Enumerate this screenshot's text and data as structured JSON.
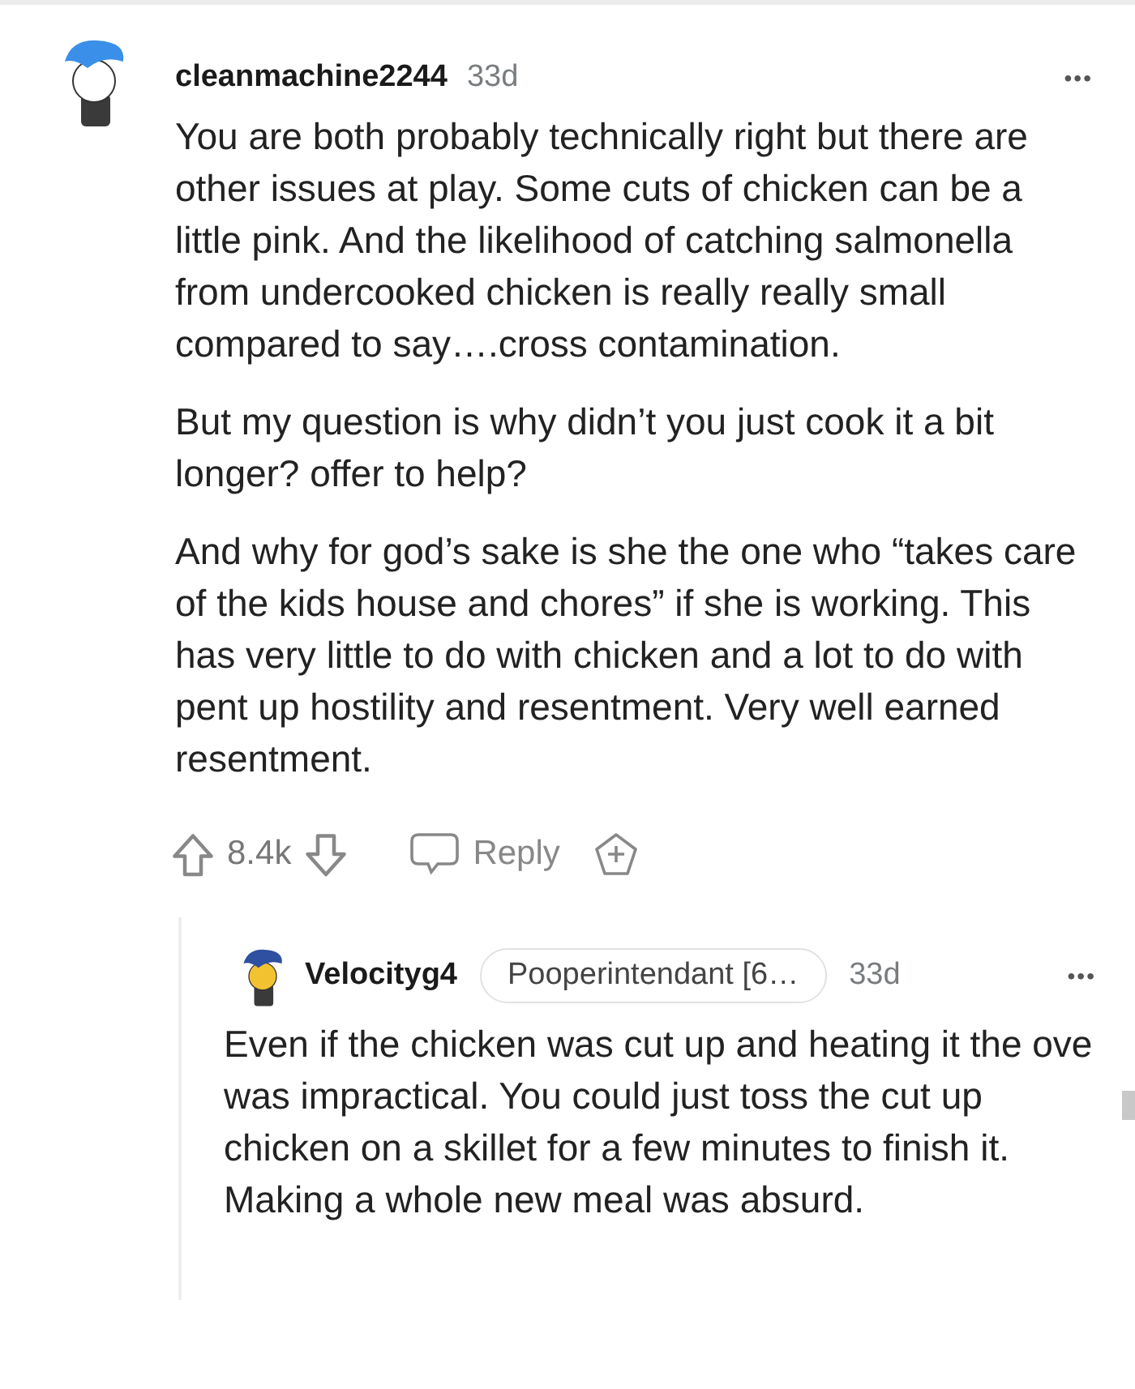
{
  "comment": {
    "author": "cleanmachine2244",
    "age": "33d",
    "more": "•••",
    "paragraphs": [
      "You are both probably technically right but there are other issues at play. Some cuts of chicken can be a little pink. And the likelihood of catching salmonella from undercooked chicken is really really small compared to say….cross contamination.",
      "But my question is why didn’t you just cook it a bit longer? offer to help?",
      "And why for god’s sake is she the one who “takes care of the kids house and chores” if she is working. This has very little to do with chicken and a lot to do with pent up hostility and resentment. Very well earned resentment."
    ],
    "votes": "8.4k",
    "reply": "Reply"
  },
  "reply": {
    "author": "Velocityg4",
    "flair": "Pooperintendant [6…",
    "age": "33d",
    "more": "•••",
    "paragraphs": [
      "Even if the chicken was cut up and heating it the ove was impractical. You could just toss the cut up chicken on a skillet for a few minutes to finish it. Making a whole new meal was absurd."
    ]
  }
}
